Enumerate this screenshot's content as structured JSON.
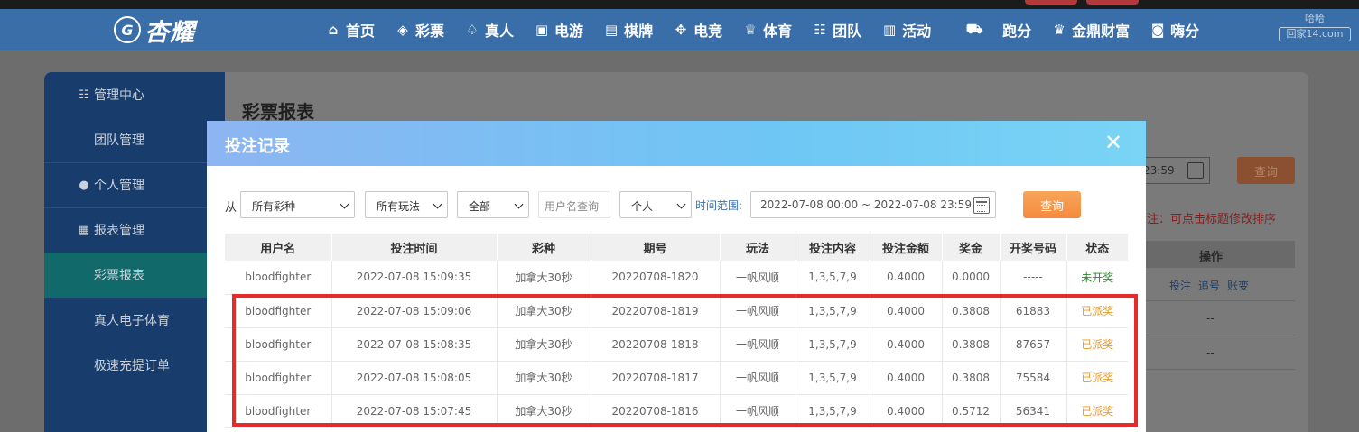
{
  "topbar": {
    "pill_color": "#b33a3a"
  },
  "navbar": {
    "logo_mark": "G",
    "logo_text": "杏耀",
    "items": [
      {
        "label": "首页",
        "icon": "home-icon"
      },
      {
        "label": "彩票",
        "icon": "lottery-ticket-icon"
      },
      {
        "label": "真人",
        "icon": "live-dealer-icon"
      },
      {
        "label": "电游",
        "icon": "slot-machine-icon"
      },
      {
        "label": "棋牌",
        "icon": "card-game-icon"
      },
      {
        "label": "电竞",
        "icon": "gamepad-icon"
      },
      {
        "label": "体育",
        "icon": "trophy-icon"
      },
      {
        "label": "团队",
        "icon": "team-icon"
      },
      {
        "label": "活动",
        "icon": "gift-icon"
      },
      {
        "label": "跑分",
        "icon": "truck-icon"
      },
      {
        "label": "金鼎财富",
        "icon": "wealth-icon"
      },
      {
        "label": "嗨分",
        "icon": "hi-icon"
      }
    ],
    "corner_logo_top": "哈哈",
    "corner_logo_box": "回家14.com"
  },
  "sidebar": {
    "items": [
      {
        "label": "管理中心",
        "type": "head",
        "icon": "team-icon"
      },
      {
        "label": "团队管理",
        "type": "sub"
      },
      {
        "label": "个人管理",
        "type": "head",
        "icon": "user-icon"
      },
      {
        "label": "报表管理",
        "type": "head",
        "icon": "report-icon"
      },
      {
        "label": "彩票报表",
        "type": "sub",
        "active": true
      },
      {
        "label": "真人电子体育",
        "type": "sub"
      },
      {
        "label": "极速充提订单",
        "type": "sub"
      }
    ]
  },
  "background": {
    "page_title": "彩票报表",
    "date_fragment": "23:59",
    "query_label": "查询",
    "note": "注：可点击标题修改排序",
    "ops_header": "操作",
    "ops_links": [
      "投注",
      "追号",
      "账变"
    ],
    "dash": "--"
  },
  "modal": {
    "title": "投注记录",
    "close_glyph": "✕",
    "filters": {
      "from_label": "从",
      "lottery_select": "所有彩种",
      "play_select": "所有玩法",
      "status_select": "全部",
      "username_placeholder": "用户名查询",
      "scope_select": "个人",
      "range_label": "时间范围:",
      "range_value": "2022-07-08 00:00 ~ 2022-07-08 23:59",
      "query_label": "查询"
    },
    "table": {
      "headers": [
        "用户名",
        "投注时间",
        "彩种",
        "期号",
        "玩法",
        "投注内容",
        "投注金额",
        "奖金",
        "开奖号码",
        "状态"
      ],
      "rows": [
        [
          "bloodfighter",
          "2022-07-08 15:09:35",
          "加拿大30秒",
          "20220708-1820",
          "一帆风顺",
          "1,3,5,7,9",
          "0.4000",
          "0.0000",
          "-----",
          "未开奖"
        ],
        [
          "bloodfighter",
          "2022-07-08 15:09:06",
          "加拿大30秒",
          "20220708-1819",
          "一帆风顺",
          "1,3,5,7,9",
          "0.4000",
          "0.3808",
          "61883",
          "已派奖"
        ],
        [
          "bloodfighter",
          "2022-07-08 15:08:35",
          "加拿大30秒",
          "20220708-1818",
          "一帆风顺",
          "1,3,5,7,9",
          "0.4000",
          "0.3808",
          "87657",
          "已派奖"
        ],
        [
          "bloodfighter",
          "2022-07-08 15:08:05",
          "加拿大30秒",
          "20220708-1817",
          "一帆风顺",
          "1,3,5,7,9",
          "0.4000",
          "0.3808",
          "75584",
          "已派奖"
        ],
        [
          "bloodfighter",
          "2022-07-08 15:07:45",
          "加拿大30秒",
          "20220708-1816",
          "一帆风顺",
          "1,3,5,7,9",
          "0.4000",
          "0.5712",
          "56341",
          "已派奖"
        ]
      ],
      "status_colors": {
        "未开奖": "#2a8a2a",
        "已派奖": "#e69a2a"
      }
    }
  },
  "annotation": {
    "highlight_color": "#e62b2b"
  }
}
